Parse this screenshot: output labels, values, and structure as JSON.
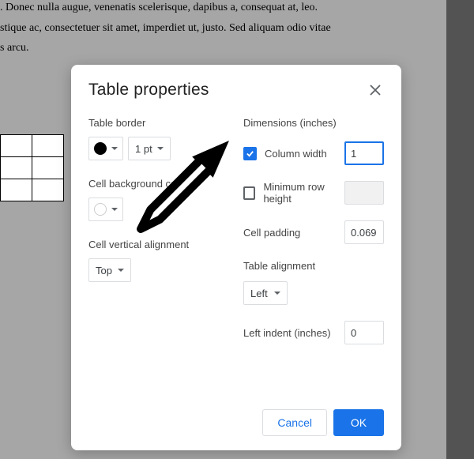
{
  "background": {
    "text_line1": ". Donec nulla augue, venenatis scelerisque, dapibus a, consequat at, leo.",
    "text_line2": "stique ac, consectetuer sit amet, imperdiet ut, justo. Sed aliquam odio vitae",
    "text_line3": "s arcu."
  },
  "modal": {
    "title": "Table properties",
    "left": {
      "border_label": "Table border",
      "border_size": "1 pt",
      "bg_label": "Cell background co",
      "valign_label": "Cell vertical alignment",
      "valign_value": "Top"
    },
    "right": {
      "dimensions_label": "Dimensions  (inches)",
      "column_width_label": "Column width",
      "column_width_value": "1",
      "row_height_label": "Minimum row height",
      "row_height_value": "",
      "cell_padding_label": "Cell padding",
      "cell_padding_value": "0.069",
      "table_align_label": "Table alignment",
      "table_align_value": "Left",
      "left_indent_label": "Left indent  (inches)",
      "left_indent_value": "0"
    },
    "footer": {
      "cancel": "Cancel",
      "ok": "OK"
    }
  }
}
